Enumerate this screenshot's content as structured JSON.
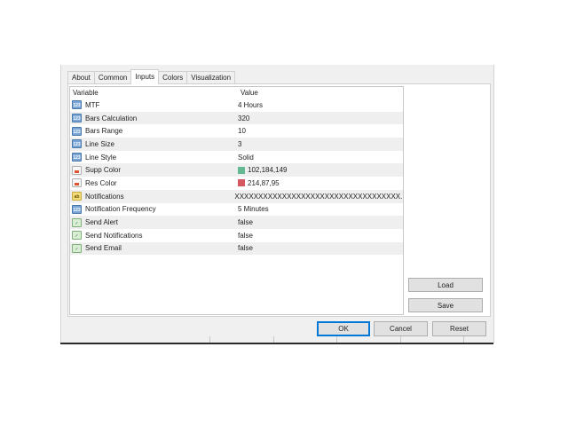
{
  "tabs": [
    {
      "label": "About"
    },
    {
      "label": "Common"
    },
    {
      "label": "Inputs"
    },
    {
      "label": "Colors"
    },
    {
      "label": "Visualization"
    }
  ],
  "active_tab": "Inputs",
  "grid": {
    "headers": {
      "variable": "Variable",
      "value": "Value"
    },
    "rows": [
      {
        "variable": "MTF",
        "value": "4 Hours",
        "icon": "numeric-parameter-icon"
      },
      {
        "variable": "Bars Calculation",
        "value": "320",
        "icon": "numeric-parameter-icon"
      },
      {
        "variable": "Bars Range",
        "value": "10",
        "icon": "numeric-parameter-icon"
      },
      {
        "variable": "Line Size",
        "value": "3",
        "icon": "numeric-parameter-icon"
      },
      {
        "variable": "Line Style",
        "value": "Solid",
        "icon": "numeric-parameter-icon"
      },
      {
        "variable": "Supp Color",
        "value": "102,184,149",
        "icon": "color-parameter-icon",
        "swatch": "#66b895"
      },
      {
        "variable": "Res Color",
        "value": "214,87,95",
        "icon": "color-parameter-icon",
        "swatch": "#d6575f"
      },
      {
        "variable": "Notifications",
        "value": "XXXXXXXXXXXXXXXXXXXXXXXXXXXXXXXXXXX...",
        "icon": "string-parameter-icon"
      },
      {
        "variable": "Notification Frequency",
        "value": "5 Minutes",
        "icon": "numeric-parameter-icon"
      },
      {
        "variable": "Send Alert",
        "value": "false",
        "icon": "boolean-parameter-icon"
      },
      {
        "variable": "Send Notifications",
        "value": "false",
        "icon": "boolean-parameter-icon"
      },
      {
        "variable": "Send Email",
        "value": "false",
        "icon": "boolean-parameter-icon"
      }
    ]
  },
  "buttons": {
    "load": "Load",
    "save": "Save",
    "ok": "OK",
    "cancel": "Cancel",
    "reset": "Reset"
  },
  "colors": {
    "accent": "#0078d7",
    "row_alt": "#efefef"
  }
}
